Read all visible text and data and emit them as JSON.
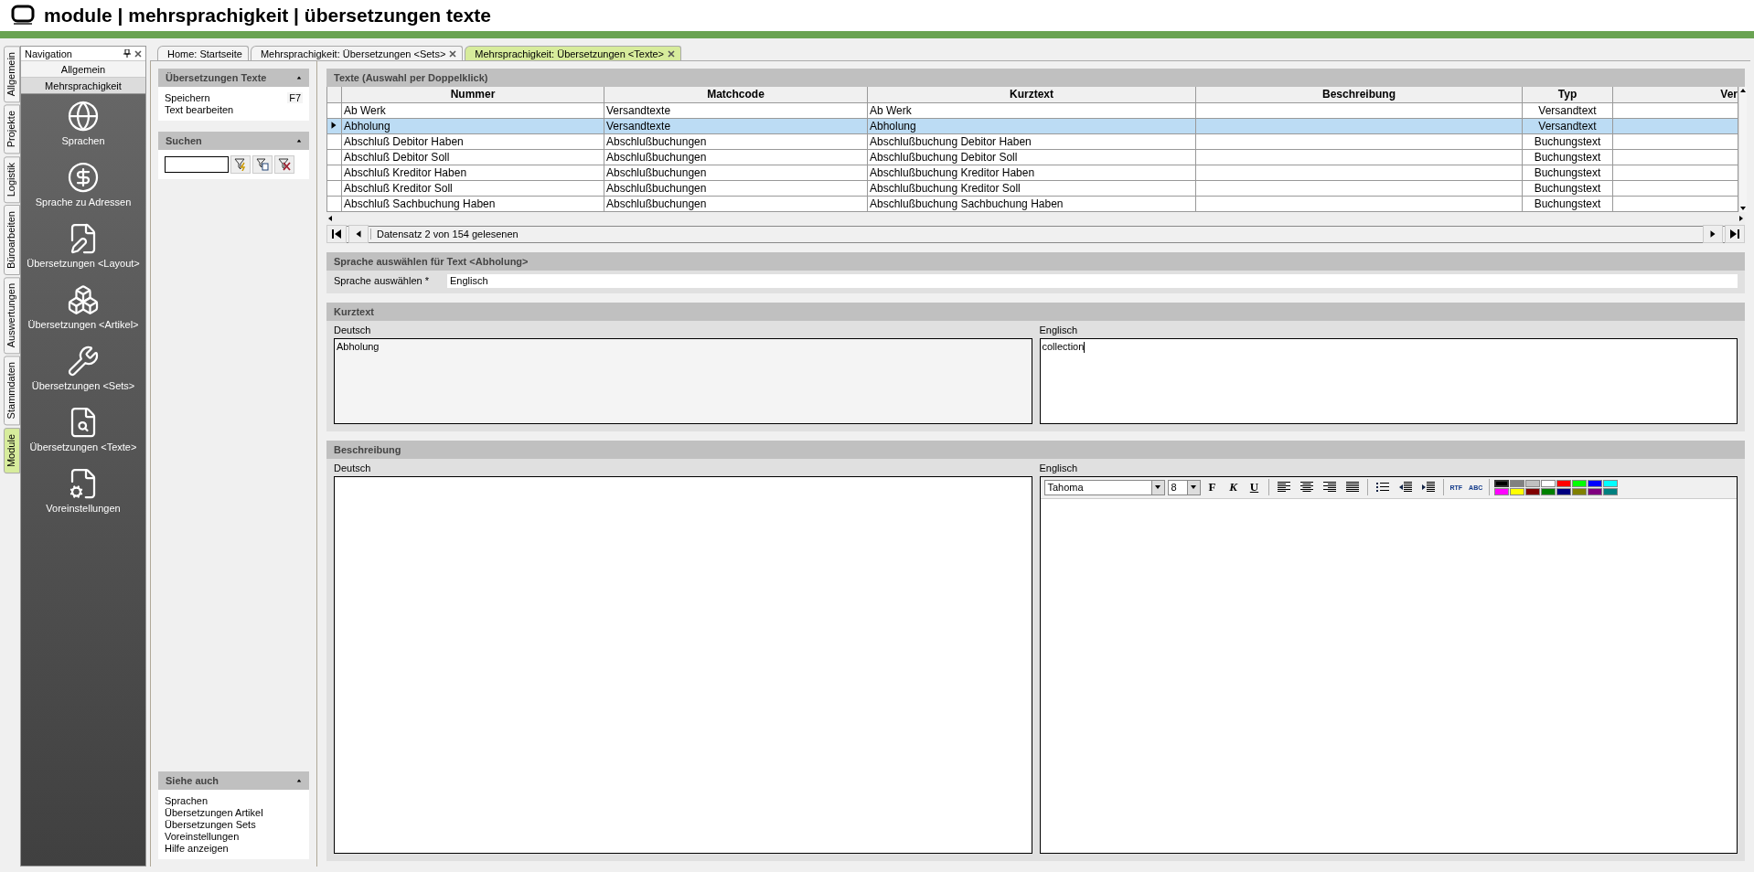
{
  "app_title": "module | mehrsprachigkeit | übersetzungen texte",
  "side_tabs": [
    {
      "label": "Allgemein",
      "selected": false
    },
    {
      "label": "Projekte",
      "selected": false
    },
    {
      "label": "Logistik",
      "selected": false
    },
    {
      "label": "Büroarbeiten",
      "selected": false
    },
    {
      "label": "Auswertungen",
      "selected": false
    },
    {
      "label": "Stammdaten",
      "selected": false
    },
    {
      "label": "Module",
      "selected": true
    }
  ],
  "navigation": {
    "title": "Navigation",
    "groups": [
      {
        "label": "Allgemein",
        "selected": false
      },
      {
        "label": "Mehrsprachigkeit",
        "selected": true
      }
    ],
    "items": [
      {
        "label": "Sprachen"
      },
      {
        "label": "Sprache zu Adressen"
      },
      {
        "label": "Übersetzungen <Layout>"
      },
      {
        "label": "Übersetzungen <Artikel>"
      },
      {
        "label": "Übersetzungen <Sets>"
      },
      {
        "label": "Übersetzungen <Texte>"
      },
      {
        "label": "Voreinstellungen"
      }
    ]
  },
  "doc_tabs": [
    {
      "label": "Home: Startseite",
      "selected": false,
      "closable": false
    },
    {
      "label": "Mehrsprachigkeit: Übersetzungen <Sets>",
      "selected": false,
      "closable": true
    },
    {
      "label": "Mehrsprachigkeit: Übersetzungen <Texte>",
      "selected": true,
      "closable": true
    }
  ],
  "tasks": {
    "title": "Übersetzungen Texte",
    "items": [
      {
        "label": "Speichern",
        "shortcut": "F7"
      },
      {
        "label": "Text bearbeiten"
      }
    ]
  },
  "search": {
    "title": "Suchen"
  },
  "see_also": {
    "title": "Siehe auch",
    "items": [
      "Sprachen",
      "Übersetzungen Artikel",
      "Übersetzungen Sets",
      "Voreinstellungen",
      "Hilfe anzeigen"
    ]
  },
  "table": {
    "title": "Texte (Auswahl per Doppelklick)",
    "columns": [
      "Nummer",
      "Matchcode",
      "Kurztext",
      "Beschreibung",
      "Typ",
      "Ver"
    ],
    "rows": [
      {
        "selected": false,
        "cells": [
          "Ab Werk",
          "Versandtexte",
          "Ab Werk",
          "",
          "Versandtext",
          ""
        ]
      },
      {
        "selected": true,
        "cells": [
          "Abholung",
          "Versandtexte",
          "Abholung",
          "",
          "Versandtext",
          ""
        ]
      },
      {
        "selected": false,
        "cells": [
          "Abschluß Debitor Haben",
          "Abschlußbuchungen",
          "Abschlußbuchung Debitor Haben",
          "",
          "Buchungstext",
          ""
        ]
      },
      {
        "selected": false,
        "cells": [
          "Abschluß Debitor Soll",
          "Abschlußbuchungen",
          "Abschlußbuchung Debitor Soll",
          "",
          "Buchungstext",
          ""
        ]
      },
      {
        "selected": false,
        "cells": [
          "Abschluß Kreditor Haben",
          "Abschlußbuchungen",
          "Abschlußbuchung Kreditor Haben",
          "",
          "Buchungstext",
          ""
        ]
      },
      {
        "selected": false,
        "cells": [
          "Abschluß Kreditor Soll",
          "Abschlußbuchungen",
          "Abschlußbuchung Kreditor Soll",
          "",
          "Buchungstext",
          ""
        ]
      },
      {
        "selected": false,
        "cells": [
          "Abschluß Sachbuchung Haben",
          "Abschlußbuchungen",
          "Abschlußbuchung Sachbuchung Haben",
          "",
          "Buchungstext",
          ""
        ]
      }
    ],
    "record_status": "Datensatz 2 von 154 gelesenen"
  },
  "language": {
    "title": "Sprache auswählen für Text <Abholung>",
    "label": "Sprache auswählen *",
    "value": "Englisch"
  },
  "short_text": {
    "title": "Kurztext",
    "source_label": "Deutsch",
    "source_value": "Abholung",
    "target_label": "Englisch",
    "target_value": "collection"
  },
  "description": {
    "title": "Beschreibung",
    "source_label": "Deutsch",
    "target_label": "Englisch",
    "editor": {
      "font": "Tahoma",
      "size": "8",
      "bold": "F",
      "italic": "K",
      "underline": "U",
      "rtf": "RTF",
      "spell": "ABC",
      "palette": [
        {
          "color": "#000000",
          "selected": true
        },
        {
          "color": "#808080",
          "selected": false
        },
        {
          "color": "#c0c0c0",
          "selected": false
        },
        {
          "color": "#ffffff",
          "selected": false
        },
        {
          "color": "#ff0000",
          "selected": false
        },
        {
          "color": "#00ff00",
          "selected": false
        },
        {
          "color": "#0000ff",
          "selected": false
        },
        {
          "color": "#00ffff",
          "selected": false
        },
        {
          "color": "#ff00ff",
          "selected": false
        },
        {
          "color": "#ffff00",
          "selected": false
        },
        {
          "color": "#800000",
          "selected": false
        },
        {
          "color": "#008000",
          "selected": false
        },
        {
          "color": "#000080",
          "selected": false
        },
        {
          "color": "#808000",
          "selected": false
        },
        {
          "color": "#800080",
          "selected": false
        },
        {
          "color": "#008080",
          "selected": false
        }
      ]
    }
  }
}
